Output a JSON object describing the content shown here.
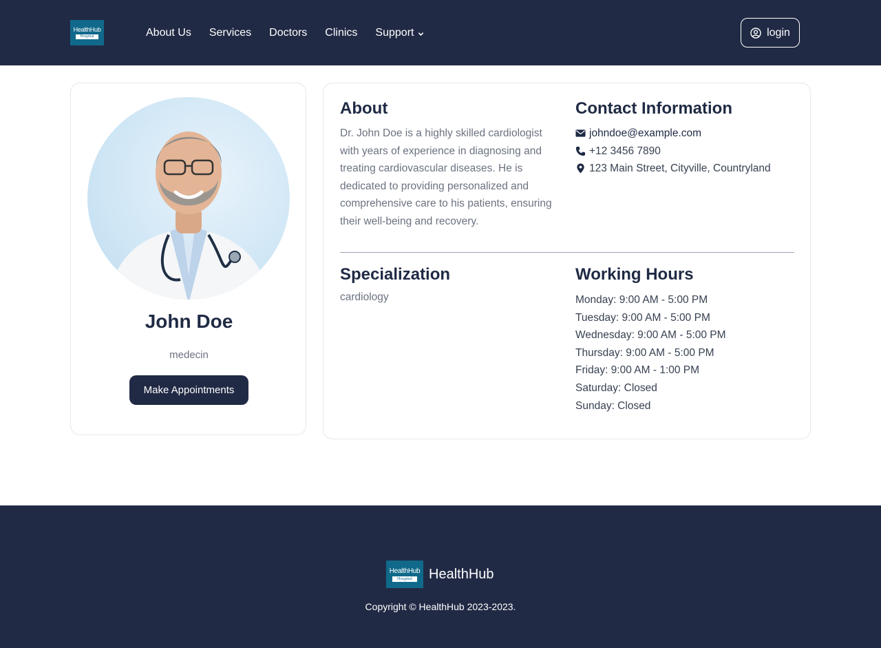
{
  "header": {
    "logo_line1": "HealthHub",
    "logo_line2": "Hospital",
    "nav": [
      "About Us",
      "Services",
      "Doctors",
      "Clinics",
      "Support"
    ],
    "login_label": "login"
  },
  "profile": {
    "name": "John Doe",
    "role": "medecin",
    "appointment_label": "Make Appointments"
  },
  "about": {
    "title": "About",
    "text": "Dr. John Doe is a highly skilled cardiologist with years of experience in diagnosing and treating cardiovascular diseases. He is dedicated to providing personalized and comprehensive care to his patients, ensuring their well-being and recovery."
  },
  "contact": {
    "title": "Contact Information",
    "email": "johndoe@example.com",
    "phone": "+12 3456 7890",
    "address": "123 Main Street, Cityville, Countryland"
  },
  "specialization": {
    "title": "Specialization",
    "value": "cardiology"
  },
  "hours": {
    "title": "Working Hours",
    "lines": [
      "Monday: 9:00 AM - 5:00 PM",
      "Tuesday: 9:00 AM - 5:00 PM",
      "Wednesday: 9:00 AM - 5:00 PM",
      "Thursday: 9:00 AM - 5:00 PM",
      "Friday: 9:00 AM - 1:00 PM",
      "Saturday: Closed",
      "Sunday: Closed"
    ]
  },
  "footer": {
    "logo_line1": "HealthHub",
    "logo_line2": "Hospital",
    "brand": "HealthHub",
    "copyright": "Copyright © HealthHub 2023-2023."
  },
  "colors": {
    "navy": "#212a45",
    "logo_teal": "#10698a"
  }
}
